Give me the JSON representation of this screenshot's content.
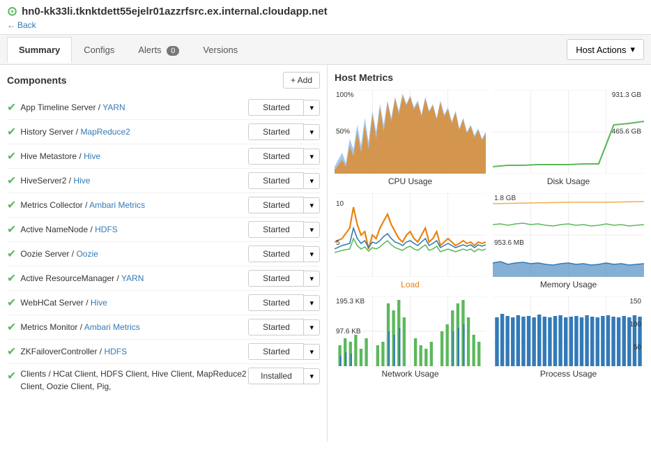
{
  "host": {
    "name": "hn0-kk33li.tknktdett55ejelr01azzrfsrc.ex.internal.cloudapp.net",
    "back_label": "Back"
  },
  "tabs": [
    {
      "id": "summary",
      "label": "Summary",
      "active": true,
      "badge": null
    },
    {
      "id": "configs",
      "label": "Configs",
      "active": false,
      "badge": null
    },
    {
      "id": "alerts",
      "label": "Alerts",
      "active": false,
      "badge": "0"
    },
    {
      "id": "versions",
      "label": "Versions",
      "active": false,
      "badge": null
    }
  ],
  "host_actions": {
    "label": "Host Actions",
    "dropdown_icon": "▾"
  },
  "components": {
    "title": "Components",
    "add_label": "+ Add",
    "items": [
      {
        "name": "App Timeline Server",
        "link": "YARN",
        "status": "Started"
      },
      {
        "name": "History Server",
        "link": "MapReduce2",
        "status": "Started"
      },
      {
        "name": "Hive Metastore",
        "link": "Hive",
        "status": "Started"
      },
      {
        "name": "HiveServer2",
        "link": "Hive",
        "status": "Started"
      },
      {
        "name": "Metrics Collector",
        "link": "Ambari Metrics",
        "status": "Started"
      },
      {
        "name": "Active NameNode",
        "link": "HDFS",
        "status": "Started"
      },
      {
        "name": "Oozie Server",
        "link": "Oozie",
        "status": "Started"
      },
      {
        "name": "Active ResourceManager",
        "link": "YARN",
        "status": "Started"
      },
      {
        "name": "WebHCat Server",
        "link": "Hive",
        "status": "Started"
      },
      {
        "name": "Metrics Monitor",
        "link": "Ambari Metrics",
        "status": "Started"
      },
      {
        "name": "ZKFailoverController",
        "link": "HDFS",
        "status": "Started"
      }
    ],
    "clients": {
      "label": "Clients",
      "names": "HCat Client, HDFS Client, Hive Client, MapReduce2 Client, Oozie Client, Pig,",
      "status": "Installed"
    }
  },
  "metrics": {
    "title": "Host Metrics",
    "charts": [
      {
        "id": "cpu",
        "label": "CPU Usage",
        "y_top": "100%",
        "y_mid": "50%"
      },
      {
        "id": "disk",
        "label": "Disk Usage",
        "y_top": "931.3 GB",
        "y_mid": "465.6 GB"
      },
      {
        "id": "load",
        "label": "Load",
        "y_top": "10",
        "y_mid": "5"
      },
      {
        "id": "memory",
        "label": "Memory Usage",
        "y_top": "1.8 GB",
        "y_mid": "953.6 MB"
      },
      {
        "id": "network",
        "label": "Network Usage",
        "y_top": "195.3 KB",
        "y_mid": "97.6 KB"
      },
      {
        "id": "process",
        "label": "Process Usage",
        "y_top": "150",
        "y_mid2": "100",
        "y_bot": "50"
      }
    ]
  }
}
